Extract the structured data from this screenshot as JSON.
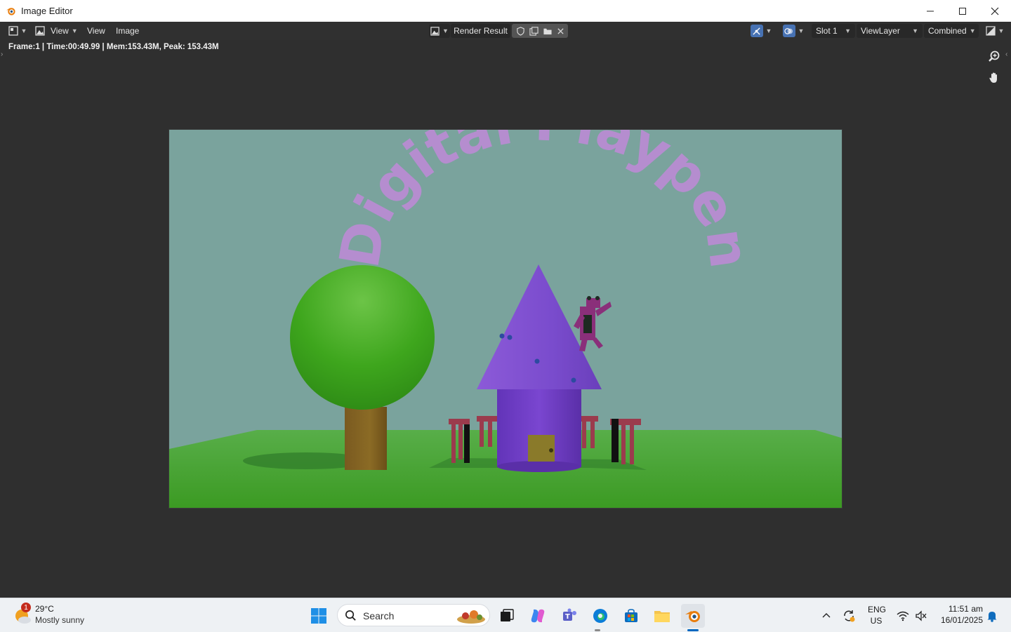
{
  "window": {
    "title": "Image Editor"
  },
  "header": {
    "view_menu_label": "View",
    "view_menu2_label": "View",
    "image_menu_label": "Image",
    "image_name": "Render Result",
    "slot": "Slot 1",
    "view_layer": "ViewLayer",
    "pass": "Combined"
  },
  "info_text": "Frame:1 | Time:00:49.99 | Mem:153.43M, Peak: 153.43M",
  "render": {
    "title_text": "Digital Playpen"
  },
  "taskbar": {
    "weather_badge": "1",
    "weather_temp": "29°C",
    "weather_desc": "Mostly sunny",
    "search_placeholder": "Search",
    "lang_line1": "ENG",
    "lang_line2": "US",
    "time": "11:51 am",
    "date": "16/01/2025"
  },
  "colors": {
    "sky": "#7aa39d",
    "grass": "#4aa63b",
    "roof": "#7f4fd0",
    "title_text": "#c08ad8",
    "blender_orange": "#e87d0d"
  }
}
